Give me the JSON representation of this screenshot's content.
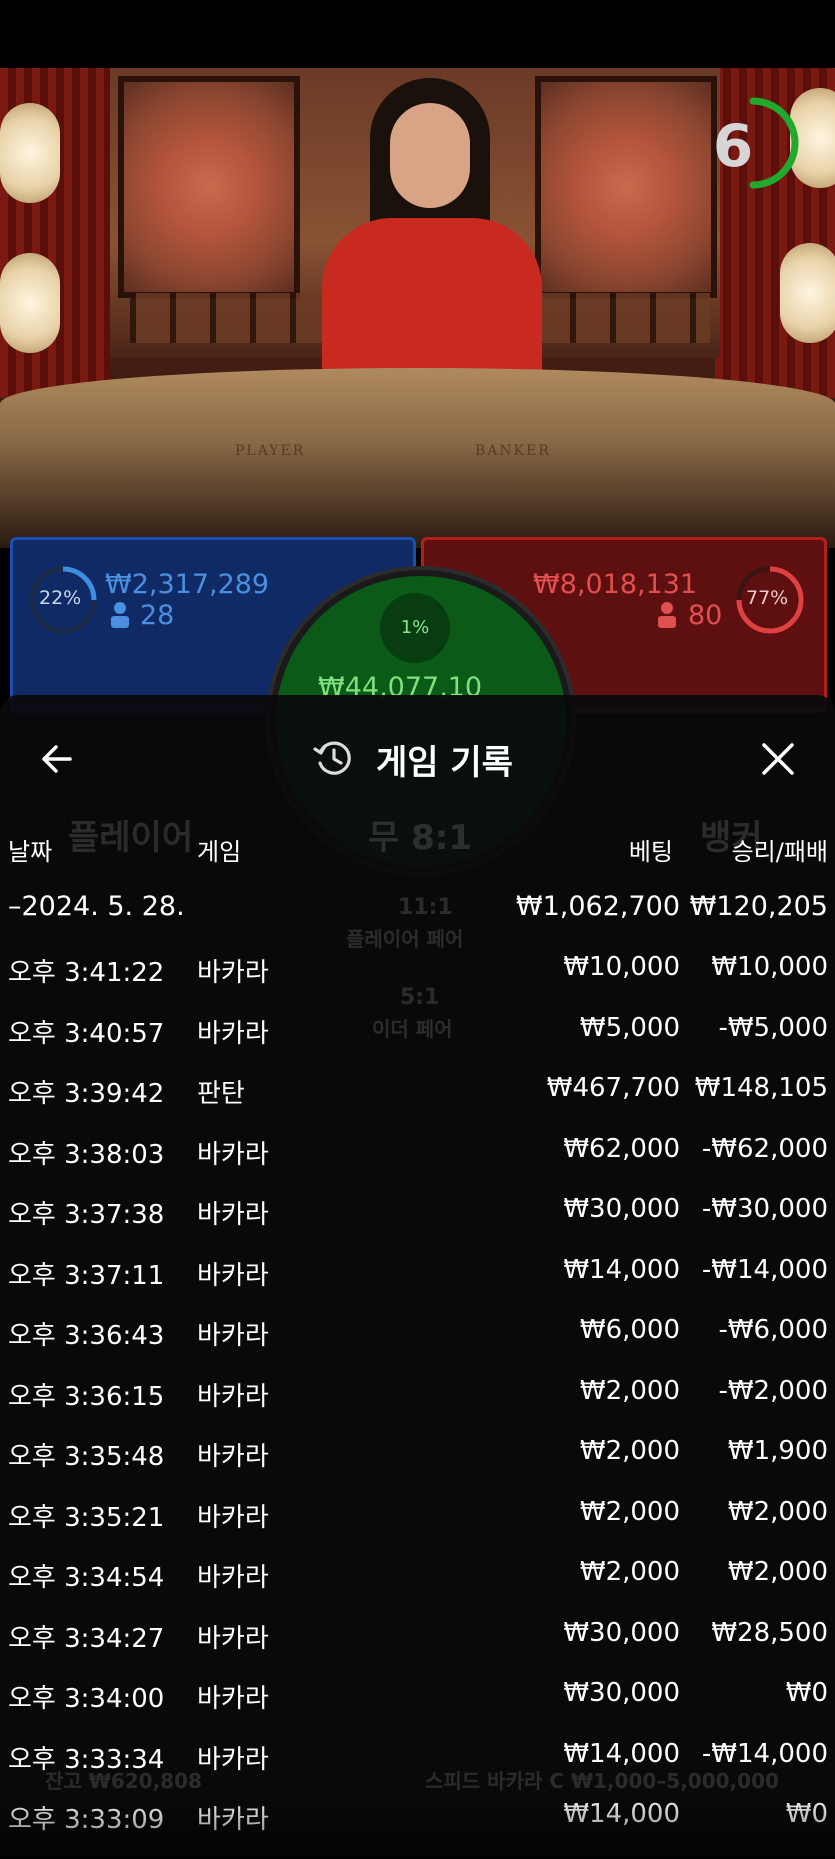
{
  "timer": {
    "value": "6",
    "fraction_remaining": 0.35
  },
  "video": {
    "table_player_label": "PLAYER",
    "table_banker_label": "BANKER"
  },
  "player_panel": {
    "percent": "22%",
    "amount": "₩2,317,289",
    "players": "28",
    "color": "#1e4fb0"
  },
  "banker_panel": {
    "percent": "77%",
    "amount": "₩8,018,131",
    "players": "80",
    "color": "#b31f1f"
  },
  "tie_panel": {
    "percent": "1%",
    "amount": "₩44,077,10",
    "color": "#0b5a17"
  },
  "history": {
    "title": "게임 기록",
    "back_icon": "arrow-left-icon",
    "history_icon": "history-icon",
    "close_icon": "close-icon",
    "columns": {
      "date": "날짜",
      "game": "게임",
      "bet": "베팅",
      "win_loss": "승리/패배"
    },
    "date_group": {
      "date": "–2024. 5. 28.",
      "total_bet": "₩1,062,700",
      "total_win": "₩120,205"
    },
    "rows": [
      {
        "time": "오후 3:41:22",
        "game": "바카라",
        "bet": "₩10,000",
        "result": "₩10,000"
      },
      {
        "time": "오후 3:40:57",
        "game": "바카라",
        "bet": "₩5,000",
        "result": "-₩5,000"
      },
      {
        "time": "오후 3:39:42",
        "game": "판탄",
        "bet": "₩467,700",
        "result": "₩148,105"
      },
      {
        "time": "오후 3:38:03",
        "game": "바카라",
        "bet": "₩62,000",
        "result": "-₩62,000"
      },
      {
        "time": "오후 3:37:38",
        "game": "바카라",
        "bet": "₩30,000",
        "result": "-₩30,000"
      },
      {
        "time": "오후 3:37:11",
        "game": "바카라",
        "bet": "₩14,000",
        "result": "-₩14,000"
      },
      {
        "time": "오후 3:36:43",
        "game": "바카라",
        "bet": "₩6,000",
        "result": "-₩6,000"
      },
      {
        "time": "오후 3:36:15",
        "game": "바카라",
        "bet": "₩2,000",
        "result": "-₩2,000"
      },
      {
        "time": "오후 3:35:48",
        "game": "바카라",
        "bet": "₩2,000",
        "result": "₩1,900"
      },
      {
        "time": "오후 3:35:21",
        "game": "바카라",
        "bet": "₩2,000",
        "result": "₩2,000"
      },
      {
        "time": "오후 3:34:54",
        "game": "바카라",
        "bet": "₩2,000",
        "result": "₩2,000"
      },
      {
        "time": "오후 3:34:27",
        "game": "바카라",
        "bet": "₩30,000",
        "result": "₩28,500"
      },
      {
        "time": "오후 3:34:00",
        "game": "바카라",
        "bet": "₩30,000",
        "result": "₩0"
      },
      {
        "time": "오후 3:33:34",
        "game": "바카라",
        "bet": "₩14,000",
        "result": "-₩14,000"
      },
      {
        "time": "오후 3:33:09",
        "game": "바카라",
        "bet": "₩14,000",
        "result": "₩0"
      }
    ]
  },
  "background_ghost": {
    "player_label": "플레이어",
    "tie_label": "무 8:1",
    "banker_label": "뱅커",
    "player_pair": "11:1",
    "player_pair_label": "플레이어 페어",
    "either_pair": "5:1",
    "either_pair_label": "이더 페어",
    "balance": "잔고 ₩620,808",
    "table_name": "스피드 바카라 C ₩1,000–5,000,000"
  }
}
